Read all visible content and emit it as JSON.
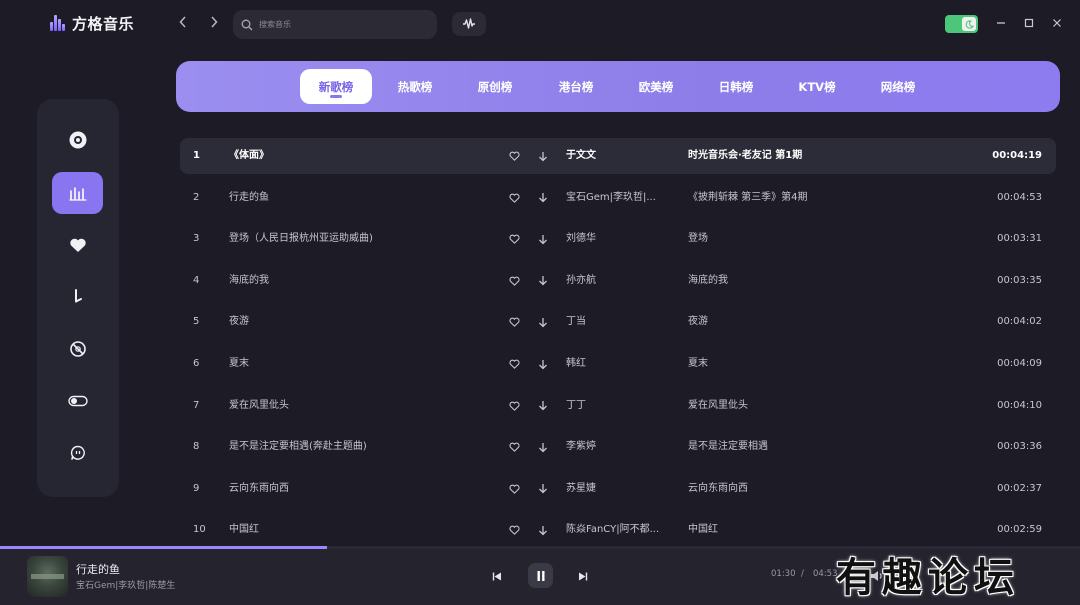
{
  "app": {
    "title": "方格音乐"
  },
  "search": {
    "placeholder": "搜索音乐"
  },
  "tabs": [
    {
      "label": "新歌榜",
      "active": true
    },
    {
      "label": "热歌榜",
      "active": false
    },
    {
      "label": "原创榜",
      "active": false
    },
    {
      "label": "港台榜",
      "active": false
    },
    {
      "label": "欧美榜",
      "active": false
    },
    {
      "label": "日韩榜",
      "active": false
    },
    {
      "label": "KTV榜",
      "active": false
    },
    {
      "label": "网络榜",
      "active": false
    }
  ],
  "sidebar": {
    "items": [
      {
        "icon": "disc-icon"
      },
      {
        "icon": "chart-bars-icon",
        "active": true
      },
      {
        "icon": "heart-icon"
      },
      {
        "icon": "music-note-icon"
      },
      {
        "icon": "no-entry-disc-icon"
      },
      {
        "icon": "toggle-icon"
      },
      {
        "icon": "chat-bubble-icon"
      }
    ]
  },
  "songs": [
    {
      "no": "1",
      "title": "《体面》",
      "artist": "于文文",
      "album": "时光音乐会·老友记 第1期",
      "duration": "00:04:19"
    },
    {
      "no": "2",
      "title": "行走的鱼",
      "artist": "宝石Gem|李玖哲|...",
      "album": "《披荆斩棘 第三季》第4期",
      "duration": "00:04:53"
    },
    {
      "no": "3",
      "title": "登场（人民日报杭州亚运助威曲)",
      "artist": "刘德华",
      "album": "登场",
      "duration": "00:03:31"
    },
    {
      "no": "4",
      "title": "海底的我",
      "artist": "孙亦航",
      "album": "海底的我",
      "duration": "00:03:35"
    },
    {
      "no": "5",
      "title": "夜游",
      "artist": "丁当",
      "album": "夜游",
      "duration": "00:04:02"
    },
    {
      "no": "6",
      "title": "夏末",
      "artist": "韩红",
      "album": "夏末",
      "duration": "00:04:09"
    },
    {
      "no": "7",
      "title": "爱在风里仳头",
      "artist": "丁丁",
      "album": "爱在风里仳头",
      "duration": "00:04:10"
    },
    {
      "no": "8",
      "title": "是不是注定要相遇(奔赴主题曲)",
      "artist": "李紫婷",
      "album": "是不是注定要相遇",
      "duration": "00:03:36"
    },
    {
      "no": "9",
      "title": "云向东雨向西",
      "artist": "苏星婕",
      "album": "云向东雨向西",
      "duration": "00:02:37"
    },
    {
      "no": "10",
      "title": "中国红",
      "artist": "陈焱FanCY|阿不都...",
      "album": "中国红",
      "duration": "00:02:59"
    }
  ],
  "player": {
    "title": "行走的鱼",
    "artist": "宝石Gem|李玖哲|陈楚生",
    "current_time": "01:30",
    "separator": "/",
    "total_time": "04:53",
    "progress": 0.303
  },
  "watermark": "有趣论坛",
  "colors": {
    "accent": "#8a75f0",
    "background": "#1d1c26",
    "toggle": "#4cc77a"
  }
}
